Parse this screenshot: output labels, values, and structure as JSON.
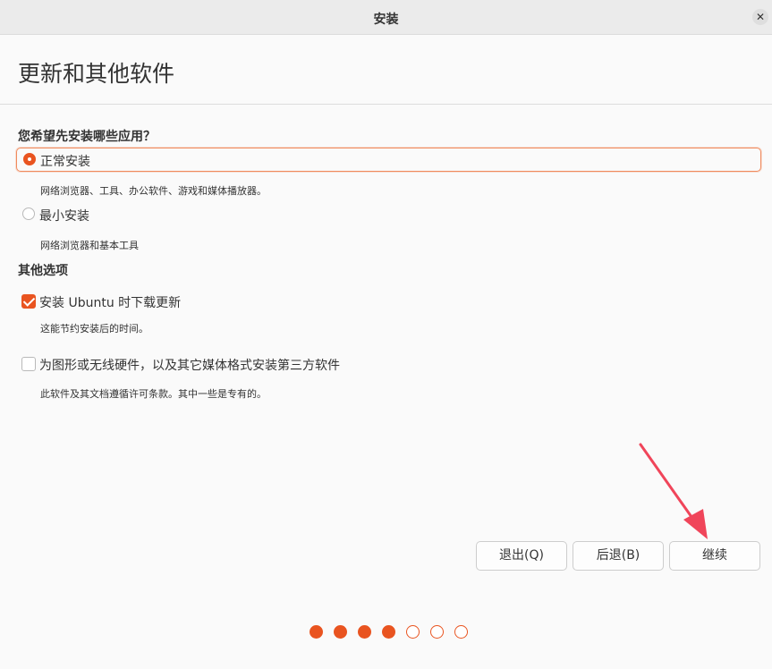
{
  "window": {
    "title": "安装"
  },
  "page": {
    "heading": "更新和其他软件"
  },
  "install_type": {
    "question": "您希望先安装哪些应用？",
    "options": [
      {
        "label": "正常安装",
        "description": "网络浏览器、工具、办公软件、游戏和媒体播放器。",
        "selected": true
      },
      {
        "label": "最小安装",
        "description": "网络浏览器和基本工具",
        "selected": false
      }
    ]
  },
  "other_options": {
    "title": "其他选项",
    "items": [
      {
        "label": "安装 Ubuntu 时下载更新",
        "description": "这能节约安装后的时间。",
        "checked": true
      },
      {
        "label": "为图形或无线硬件，以及其它媒体格式安装第三方软件",
        "description": "此软件及其文档遵循许可条款。其中一些是专有的。",
        "checked": false
      }
    ]
  },
  "buttons": {
    "quit": "退出(Q)",
    "back": "后退(B)",
    "continue": "继续"
  },
  "progress": {
    "current_step": 4,
    "total_steps": 7
  },
  "colors": {
    "accent": "#e95420",
    "annotation_arrow": "#f0455a"
  }
}
